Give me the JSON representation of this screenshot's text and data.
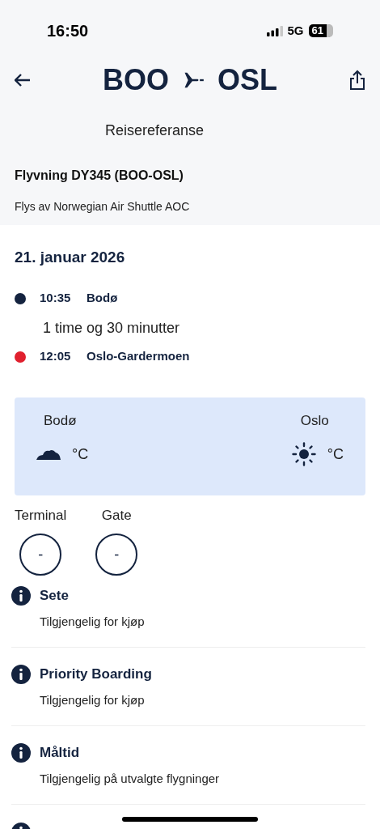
{
  "status_bar": {
    "time": "16:50",
    "network": "5G",
    "battery": "61"
  },
  "header": {
    "origin": "BOO",
    "destination": "OSL",
    "subtitle": "Reisereferanse"
  },
  "flight": {
    "title": "Flyvning DY345 (BOO-OSL)",
    "operator": "Flys av Norwegian Air Shuttle AOC"
  },
  "date": "21. januar 2026",
  "stops": [
    {
      "time": "10:35",
      "place": "Bodø",
      "color": "#14233f"
    },
    {
      "time": "12:05",
      "place": "Oslo-Gardermoen",
      "color": "#e0202e"
    }
  ],
  "duration": "1 time og 30 minutter",
  "weather": [
    {
      "city": "Bodø",
      "kind": "cloud",
      "unit": "°C"
    },
    {
      "city": "Oslo",
      "kind": "sun",
      "unit": "°C"
    }
  ],
  "gates": [
    {
      "label": "Terminal",
      "value": "-"
    },
    {
      "label": "Gate",
      "value": "-"
    }
  ],
  "services": [
    {
      "kind": "info",
      "title": "Sete",
      "detail": "Tilgjengelig for kjøp"
    },
    {
      "kind": "info",
      "title": "Priority Boarding",
      "detail": "Tilgjengelig for kjøp"
    },
    {
      "kind": "info",
      "title": "Måltid",
      "detail": "Tilgjengelig på utvalgte flygninger"
    },
    {
      "kind": "partial"
    }
  ]
}
